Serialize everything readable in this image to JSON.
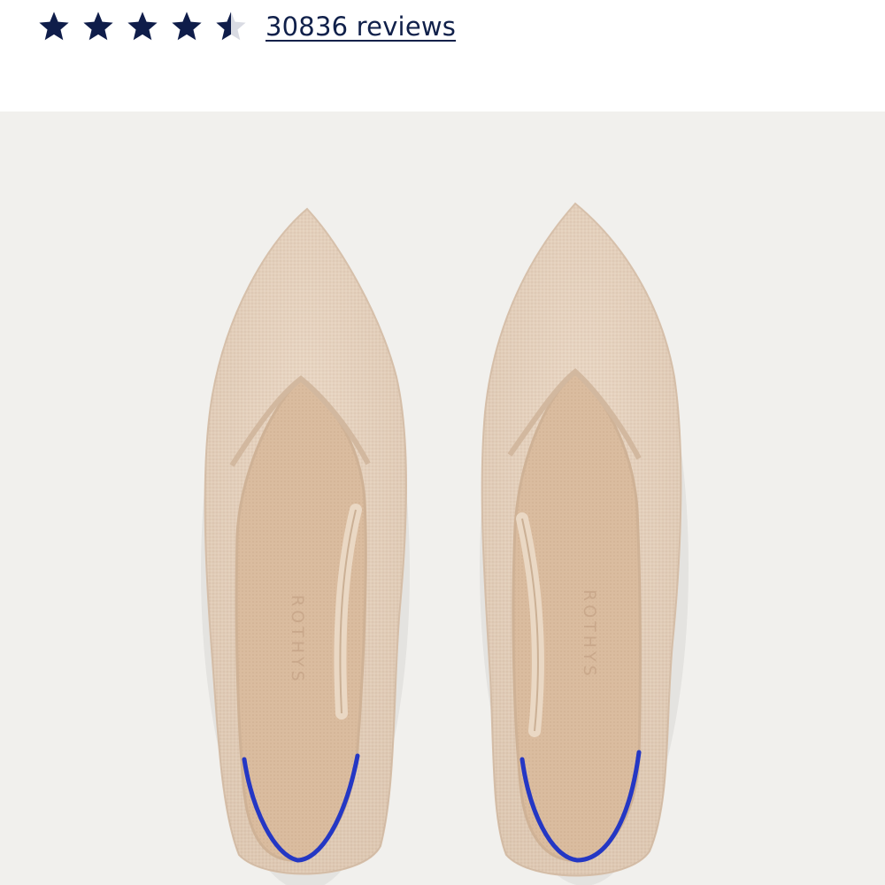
{
  "rating": {
    "value": 4.5,
    "max": 5,
    "star_color": "#0f1d4a",
    "empty_star_color": "#d9dbe3",
    "reviews_label": "30836 reviews"
  },
  "product_image": {
    "description_icon": "shoe-pair-icon",
    "brand_mark": "ROTHYS",
    "background": "#f1f0ed",
    "shoe_color": "#e7d2bd",
    "insole_color": "#dcbea1",
    "heel_accent_color": "#2437c4"
  }
}
